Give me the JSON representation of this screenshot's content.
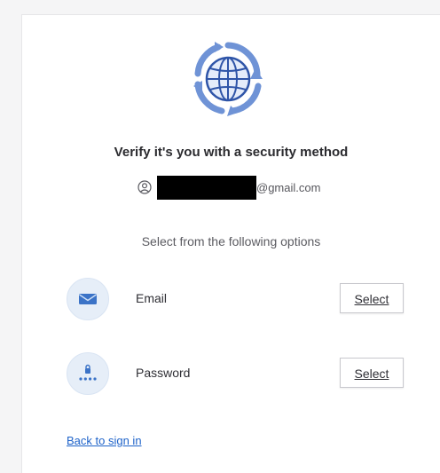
{
  "header": {
    "title": "Verify it's you with a security method"
  },
  "identity": {
    "email_suffix": "@gmail.com"
  },
  "instructions": "Select from the following options",
  "options": [
    {
      "label": "Email",
      "icon": "envelope-icon",
      "button_label": "Select"
    },
    {
      "label": "Password",
      "icon": "password-lock-icon",
      "button_label": "Select"
    }
  ],
  "footer": {
    "back_link": "Back to sign in"
  },
  "colors": {
    "accent": "#1d62c9",
    "icon_bg": "#e6eef8",
    "globe": "#4a78c9"
  }
}
